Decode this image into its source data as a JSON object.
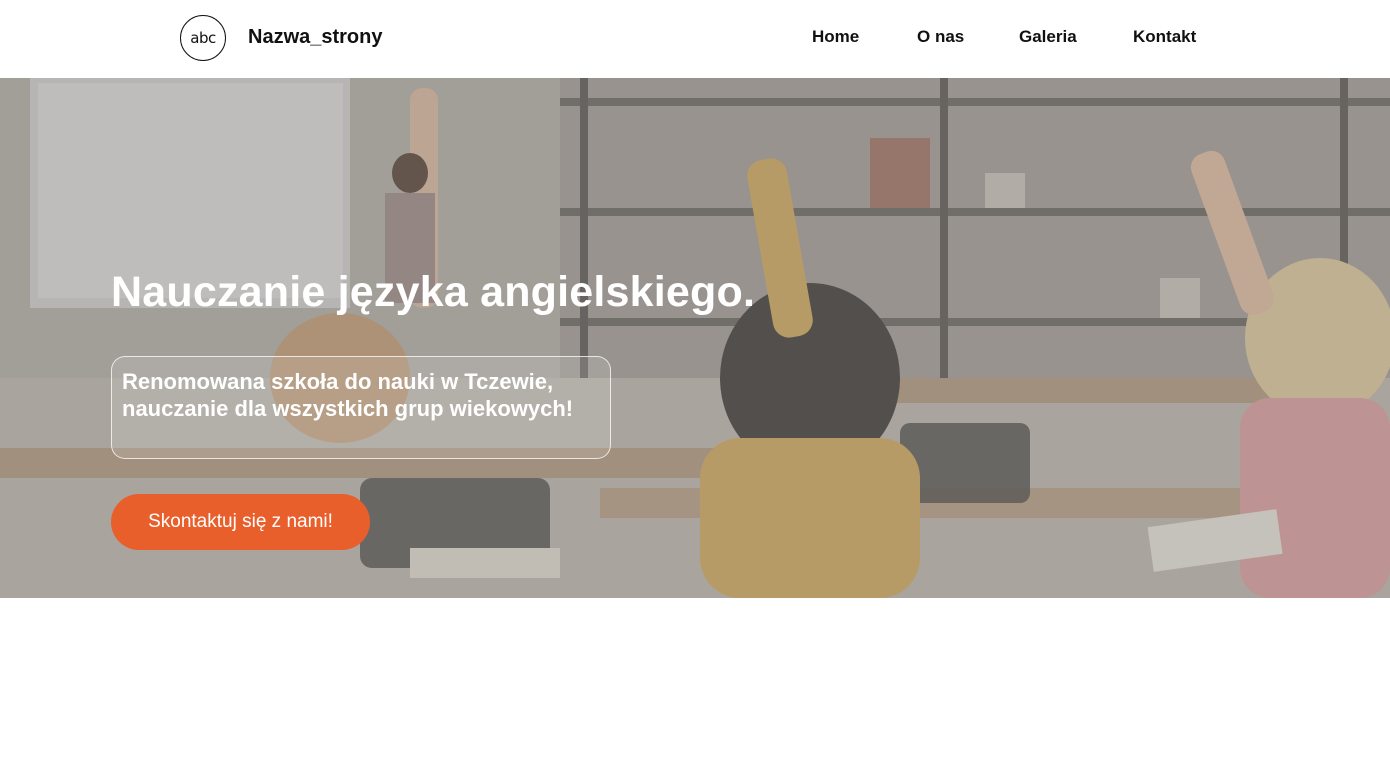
{
  "header": {
    "logo_text": "abc",
    "site_name": "Nazwa_strony"
  },
  "nav": {
    "items": [
      {
        "label": "Home"
      },
      {
        "label": "O nas"
      },
      {
        "label": "Galeria"
      },
      {
        "label": "Kontakt"
      }
    ]
  },
  "hero": {
    "title": "Nauczanie języka angielskiego.",
    "subtitle": "Renomowana szkoła do nauki w Tczewie, nauczanie dla wszystkich grup wiekowych!",
    "cta_label": "Skontaktuj się z nami!"
  },
  "colors": {
    "accent": "#e85f2c",
    "text": "#111111",
    "hero_text": "#ffffff"
  }
}
